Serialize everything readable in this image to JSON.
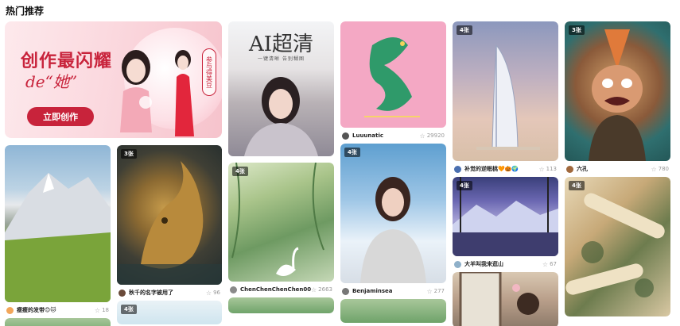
{
  "section": {
    "title": "热门推荐"
  },
  "banner": {
    "title_line1": "创作最闪耀",
    "title_line2": "de“她”",
    "tag": "参与得美豆",
    "cta_label": "立即创作"
  },
  "ai_card": {
    "title": "AI超清",
    "subtitle": "一键清晰  告别糊图"
  },
  "cards": [
    {
      "id": "mountain",
      "badge": "",
      "user": "瘦瘦的发带😊🐱",
      "count": "18"
    },
    {
      "id": "golden-dragon",
      "badge": "3张",
      "user": "秋千的名字被用了",
      "count": "96"
    },
    {
      "id": "ai-girl",
      "badge": "",
      "user": "",
      "count": ""
    },
    {
      "id": "willow-swan",
      "badge": "4张",
      "user": "ChenChenChenChen00",
      "count": "2663"
    },
    {
      "id": "green-dragon",
      "badge": "",
      "user": "Luuunatic",
      "count": "29920"
    },
    {
      "id": "snow-girl",
      "badge": "4张",
      "user": "Benjaminsea",
      "count": "277"
    },
    {
      "id": "tower",
      "badge": "4张",
      "user": "补觉的逆眠桃🧡🎃🌍",
      "count": "113"
    },
    {
      "id": "lake",
      "badge": "4张",
      "user": "大羊叫我来逛山",
      "count": "67"
    },
    {
      "id": "window",
      "badge": "",
      "user": "",
      "count": ""
    },
    {
      "id": "cartoon",
      "badge": "3张",
      "user": "六孔",
      "count": "780"
    },
    {
      "id": "scroll",
      "badge": "4张",
      "user": "",
      "count": ""
    },
    {
      "id": "bottom-left",
      "badge": "",
      "user": "",
      "count": ""
    },
    {
      "id": "bottom-mid",
      "badge": "4张",
      "user": "",
      "count": ""
    },
    {
      "id": "bottom-willow",
      "badge": "",
      "user": "",
      "count": ""
    }
  ],
  "colors": {
    "brand": "#c8233b",
    "badge_bg": "rgba(0,0,0,0.55)"
  },
  "icons": {
    "like": "star-icon"
  }
}
